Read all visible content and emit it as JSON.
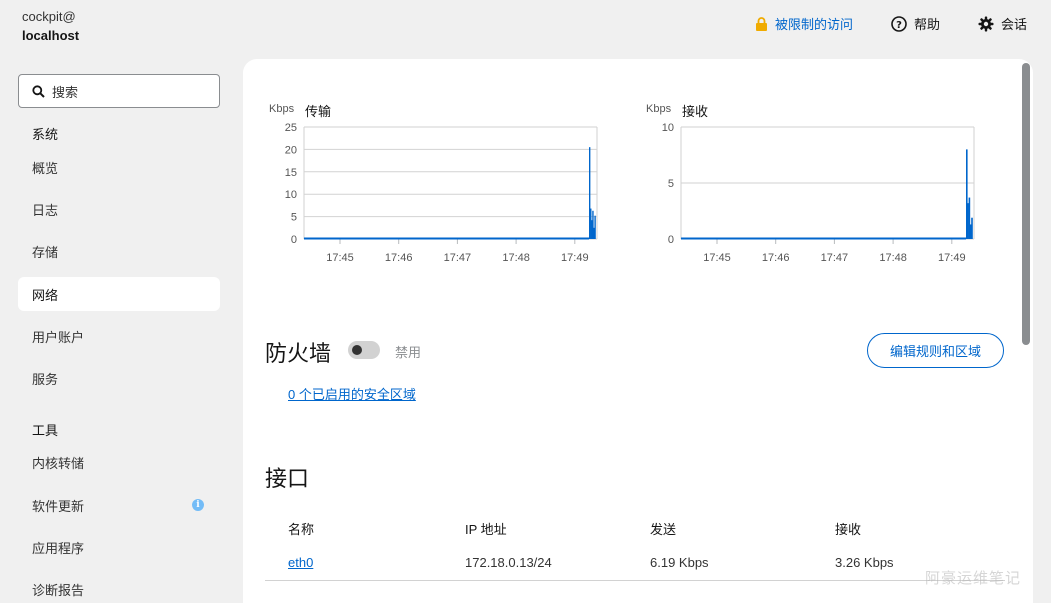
{
  "host": {
    "user": "cockpit@",
    "hostname": "localhost"
  },
  "topbar": {
    "access": {
      "label": "被限制的访问",
      "icon": "lock-icon"
    },
    "help": {
      "label": "帮助",
      "icon": "help-icon"
    },
    "session": {
      "label": "会话",
      "icon": "gear-icon"
    }
  },
  "sidebar": {
    "search_placeholder": "搜索",
    "group_system": "系统",
    "group_tools": "工具",
    "items": [
      {
        "label": "概览"
      },
      {
        "label": "日志"
      },
      {
        "label": "存储"
      },
      {
        "label": "网络",
        "active": true
      },
      {
        "label": "用户账户"
      },
      {
        "label": "服务"
      },
      {
        "label": "内核转储"
      },
      {
        "label": "软件更新",
        "badge": "i"
      },
      {
        "label": "应用程序"
      },
      {
        "label": "诊断报告"
      }
    ]
  },
  "charts": [
    {
      "title": "传输",
      "unit": "Kbps",
      "y_ticks": [
        "25",
        "20",
        "15",
        "10",
        "5",
        "0"
      ],
      "x_ticks": [
        "17:45",
        "17:46",
        "17:47",
        "17:48",
        "17:49"
      ],
      "ymax": 25,
      "spike": [
        20.5,
        6.8,
        4.2,
        6.3,
        2.5,
        5.2
      ],
      "color": "#06c"
    },
    {
      "title": "接收",
      "unit": "Kbps",
      "y_ticks": [
        "10",
        "5",
        "0"
      ],
      "x_ticks": [
        "17:45",
        "17:46",
        "17:47",
        "17:48",
        "17:49"
      ],
      "ymax": 10,
      "spike": [
        8.0,
        3.2,
        3.7,
        1.3,
        1.9
      ],
      "color": "#06c"
    }
  ],
  "firewall": {
    "title": "防火墙",
    "state": "禁用",
    "enabled": false,
    "edit_button": "编辑规则和区域",
    "zones_link": "0 个已启用的安全区域"
  },
  "interfaces": {
    "title": "接口",
    "columns": [
      "名称",
      "IP 地址",
      "发送",
      "接收"
    ],
    "rows": [
      {
        "name": "eth0",
        "ip": "172.18.0.13/24",
        "send": "6.19 Kbps",
        "recv": "3.26 Kbps"
      }
    ]
  },
  "watermark": "阿豪运维笔记"
}
